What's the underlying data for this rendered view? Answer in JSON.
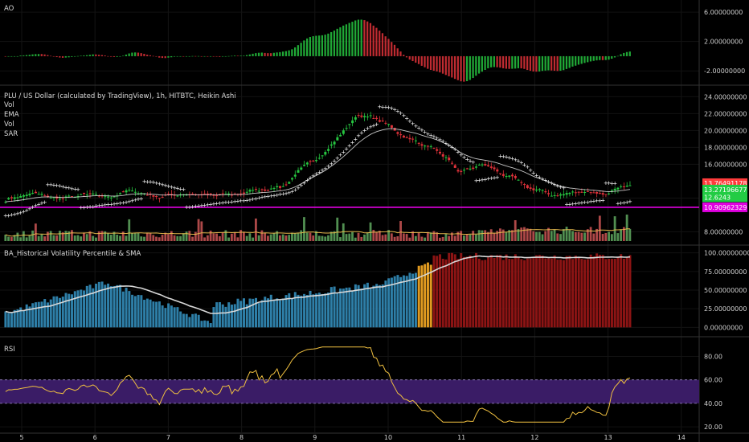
{
  "chart_data": [
    {
      "type": "bar",
      "panel": "ao",
      "title": "AO",
      "y_ticks": [
        "6.00000000",
        "2.00000000",
        "-2.00000000"
      ],
      "y_tick_values": [
        6,
        2,
        -2
      ],
      "ylim": [
        -3.4,
        7.0
      ]
    },
    {
      "type": "candlestick",
      "panel": "price",
      "title": "PLU / US Dollar (calculated by TradingView), 1h, HITBTC, Heikin Ashi",
      "legend": [
        "Vol",
        "EMA",
        "Vol",
        "SAR"
      ],
      "y_ticks": [
        "24.00000000",
        "22.00000000",
        "20.00000000",
        "18.00000000",
        "16.00000000",
        "12.00000000",
        "8.00000000"
      ],
      "y_tick_values": [
        24,
        22,
        20,
        18,
        16,
        12,
        8
      ],
      "ylim": [
        7.0,
        24.6
      ],
      "price_labels": [
        {
          "text": "13.76491178",
          "value": 13.76,
          "color": "#ff3b3b"
        },
        {
          "text": "13.27196677",
          "value": 13.0,
          "color": "#22cc44"
        },
        {
          "text": "12.6243",
          "value": 12.1,
          "color": "#22cc44"
        },
        {
          "text": "10.90962329",
          "value": 10.91,
          "color": "#e000e0"
        }
      ],
      "horizontal_line": 10.91,
      "key_prices": [
        12.0,
        12.5,
        11.9,
        12.3,
        12.2,
        12.9,
        12.1,
        12.6,
        12.2,
        12.4,
        13.0,
        13.4,
        16.0,
        18.5,
        22.0,
        21.0,
        19.0,
        18.0,
        15.0,
        16.0,
        14.5,
        13.0,
        12.3,
        12.9,
        12.4,
        13.7
      ]
    },
    {
      "type": "bar",
      "panel": "volatility",
      "title": "BA_Historical Volatility Percentile & SMA",
      "y_ticks": [
        "100.00000000",
        "75.00000000",
        "50.00000000",
        "25.00000000",
        "0.00000000"
      ],
      "y_tick_values": [
        100,
        75,
        50,
        25,
        0
      ],
      "ylim": [
        -5,
        105
      ]
    },
    {
      "type": "line",
      "panel": "rsi",
      "title": "RSI",
      "y_ticks": [
        "80.00",
        "60.00",
        "40.00",
        "20.00"
      ],
      "y_tick_values": [
        80,
        60,
        40,
        20
      ],
      "ylim": [
        18,
        92
      ],
      "band": [
        40,
        60
      ]
    }
  ],
  "x_axis": {
    "ticks": [
      "5",
      "6",
      "7",
      "8",
      "9",
      "10",
      "11",
      "12",
      "13",
      "14"
    ],
    "day_values": [
      5,
      6,
      7,
      8,
      9,
      10,
      11,
      12,
      13,
      14
    ]
  },
  "colors": {
    "up": "#26c540",
    "down": "#e0323a",
    "vol_up": "#5a9e5a",
    "vol_down": "#c05050",
    "ema": "#e8e8e8",
    "vol_ma": "#e6b84c",
    "sar": "#ffffff",
    "hvp_low": "#2e7fa8",
    "hvp_mid": "#e09a20",
    "hvp_high": "#8c1414",
    "hvp_sma": "#d8d8d8",
    "rsi_line": "#f0c040",
    "rsi_band": "#3a1c66",
    "magenta": "#e000e0"
  }
}
